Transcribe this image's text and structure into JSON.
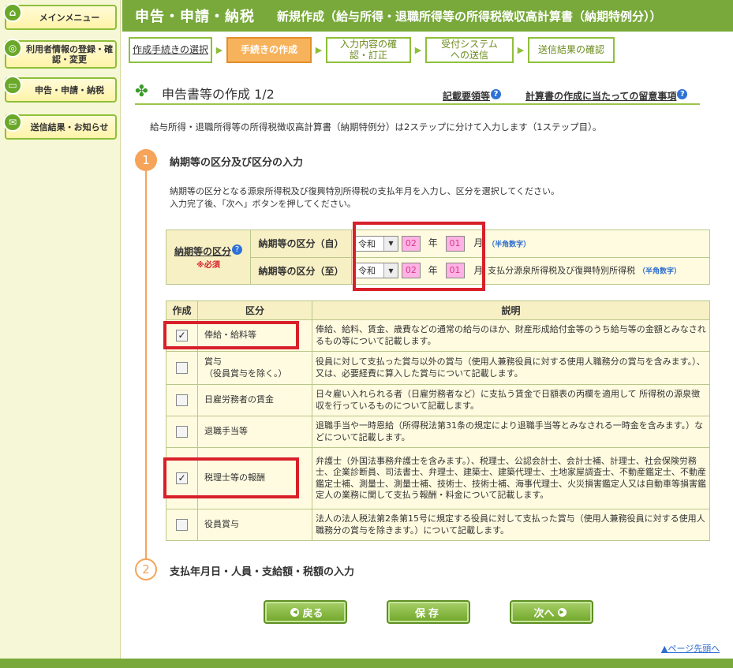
{
  "sidebar": {
    "items": [
      {
        "label": "メインメニュー",
        "icon": "home-icon"
      },
      {
        "label": "利用者情報の登録・確認・変更",
        "icon": "settings-icon"
      },
      {
        "label": "申告・申請・納税",
        "icon": "document-icon"
      },
      {
        "label": "送信結果・お知らせ",
        "icon": "mail-icon"
      }
    ]
  },
  "header": {
    "title": "申告・申請・納税",
    "subtitle": "新規作成（給与所得・退職所得等の所得税徴収高計算書（納期特例分））"
  },
  "steps": [
    {
      "label": "作成手続きの選択",
      "state": "done"
    },
    {
      "label": "手続きの作成",
      "state": "active"
    },
    {
      "label": "入力内容の確認・訂正",
      "state": "todo"
    },
    {
      "label": "受付システムへの送信",
      "state": "todo"
    },
    {
      "label": "送信結果の確認",
      "state": "todo"
    }
  ],
  "page": {
    "title": "申告書等の作成 1/2",
    "help1": "記載要領等",
    "help2": "計算書の作成に当たっての留意事項",
    "intro": "給与所得・退職所得等の所得税徴収高計算書（納期特例分）は2ステップに分けて入力します（1ステップ目）。"
  },
  "section1": {
    "number": "1",
    "title": "納期等の区分及び区分の入力",
    "desc1": "納期等の区分となる源泉所得税及び復興特別所得税の支払年月を入力し、区分を選択してください。",
    "desc2": "入力完了後、「次へ」ボタンを押してください。"
  },
  "period": {
    "label": "納期等の区分",
    "required": "※必須",
    "from_label": "納期等の区分（自）",
    "to_label": "納期等の区分（至）",
    "era": "令和",
    "from_year": "02",
    "from_month": "01",
    "to_year": "02",
    "to_month": "01",
    "year_unit": "年",
    "month_unit": "月",
    "hankaku": "（半角数字）",
    "suffix": "支払分源泉所得税及び復興特別所得税"
  },
  "table": {
    "headers": [
      "作成",
      "区分",
      "説明"
    ],
    "rows": [
      {
        "checked": true,
        "kubun": "俸給・給料等",
        "desc": "俸給、給料、賃金、歳費などの通常の給与のほか、財産形成給付金等のうち給与等の金額とみなされるもの等について記載します。"
      },
      {
        "checked": false,
        "kubun": "賞与\n（役員賞与を除く。）",
        "desc": "役員に対して支払った賞与以外の賞与（使用人兼務役員に対する使用人職務分の賞与を含みます。）、又は、必要経費に算入した賞与について記載します。"
      },
      {
        "checked": false,
        "kubun": "日雇労務者の賃金",
        "desc": "日々雇い入れられる者（日雇労務者など）に支払う賃金で日額表の丙欄を適用して 所得税の源泉徴収を行っているものについて記載します。"
      },
      {
        "checked": false,
        "kubun": "退職手当等",
        "desc": "退職手当や一時恩給（所得税法第31条の規定により退職手当等とみなされる一時金を含みます。）などについて記載します。"
      },
      {
        "checked": true,
        "kubun": "税理士等の報酬",
        "desc": "弁護士（外国法事務弁護士を含みます。）、税理士、公認会計士、会計士補、計理士、社会保険労務士、企業診断員、司法書士、弁理士、建築士、建築代理士、土地家屋調査士、不動産鑑定士、不動産鑑定士補、測量士、測量士補、技術士、技術士補、海事代理士、火災損害鑑定人又は自動車等損害鑑定人の業務に関して支払う報酬・料金について記載します。"
      },
      {
        "checked": false,
        "kubun": "役員賞与",
        "desc": "法人の法人税法第2条第15号に規定する役員に対して支払った賞与（使用人兼務役員に対する使用人職務分の賞与を除きます。）について記載します。"
      }
    ]
  },
  "section2": {
    "number": "2",
    "title": "支払年月日・人員・支給額・税額の入力"
  },
  "buttons": {
    "back": "戻る",
    "save": "保存",
    "next": "次へ"
  },
  "page_top": "ページ先頭へ",
  "colors": {
    "accent": "#78a93a",
    "active_step": "#f7b25c",
    "highlight": "#d8202a"
  }
}
